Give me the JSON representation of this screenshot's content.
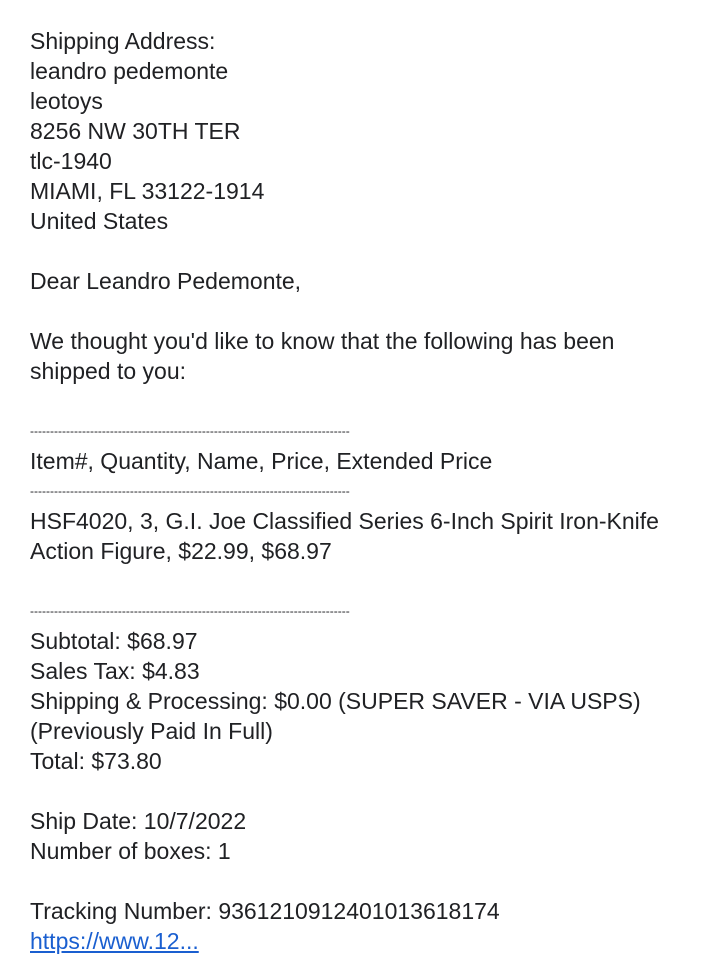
{
  "shipping": {
    "heading": "Shipping Address:",
    "name": "leandro pedemonte",
    "company": "leotoys",
    "street": "8256 NW 30TH TER",
    "unit": "tlc-1940",
    "city_state_zip": "MIAMI, FL 33122-1914",
    "country": "United States"
  },
  "greeting": "Dear Leandro Pedemonte,",
  "intro": "We thought you'd like to know that the following has been shipped to you:",
  "separator": "--------------------------------------------------------------------------------",
  "table": {
    "header": "Item#,  Quantity,  Name,  Price,  Extended Price",
    "row": "HSF4020,  3,  G.I. Joe Classified Series 6-Inch Spirit Iron-Knife Action Figure,  $22.99,  $68.97"
  },
  "totals": {
    "subtotal": "Subtotal: $68.97",
    "sales_tax": "Sales Tax:  $4.83",
    "shipping": "Shipping & Processing: $0.00 (SUPER SAVER - VIA USPS)",
    "paid_note": "(Previously Paid In Full)",
    "total": "Total: $73.80"
  },
  "shipment": {
    "ship_date": "Ship Date: 10/7/2022",
    "boxes": "Number of boxes: 1",
    "tracking": "Tracking Number: 9361210912401013618174",
    "tracking_link": "https://www.12..."
  }
}
